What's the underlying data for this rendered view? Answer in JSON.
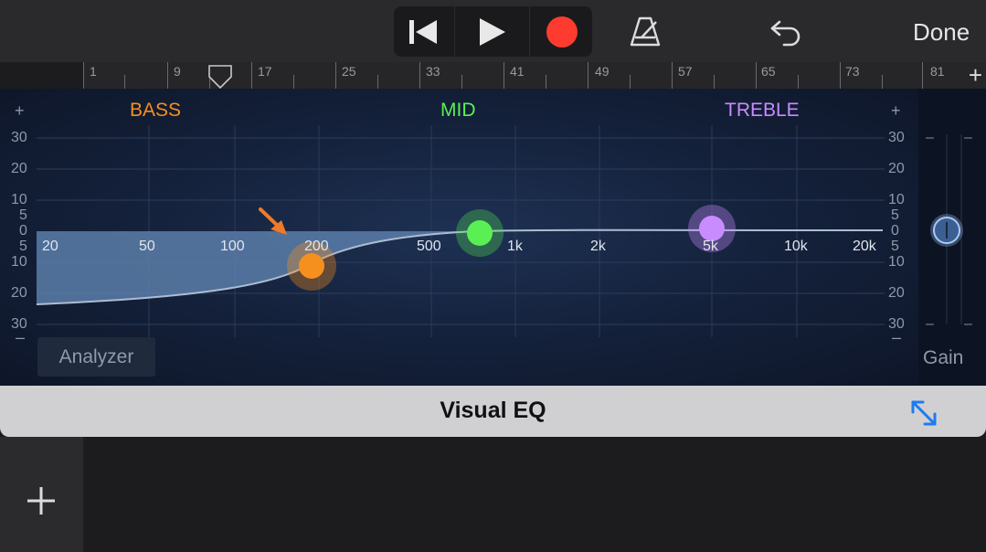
{
  "header": {
    "done_label": "Done",
    "transport_icons": [
      "go-to-beginning-icon",
      "play-icon",
      "record-icon"
    ],
    "metronome_icon": "metronome-icon",
    "undo_icon": "undo-icon"
  },
  "ruler": {
    "bars": [
      "1",
      "9",
      "17",
      "25",
      "33",
      "41",
      "49",
      "57",
      "65",
      "73",
      "81"
    ],
    "add_label": "+"
  },
  "eq": {
    "bands": {
      "bass": "BASS",
      "mid": "MID",
      "treble": "TREBLE"
    },
    "add_left": "+",
    "add_right": "+",
    "minus_left": "–",
    "minus_right": "–",
    "db_labels": [
      "30",
      "20",
      "10",
      "5",
      "0",
      "5",
      "10",
      "20",
      "30"
    ],
    "freq_labels": [
      "20",
      "50",
      "100",
      "200",
      "500",
      "1k",
      "2k",
      "5k",
      "10k",
      "20k"
    ],
    "analyzer_label": "Analyzer",
    "gain_label": "Gain",
    "colors": {
      "bass": "#f5901e",
      "mid": "#5af054",
      "treble": "#c88cff",
      "gain_knob": "#a9c8ff"
    },
    "bass_knob": {
      "freq": "190 Hz",
      "gain_db": -11
    },
    "mid_knob": {
      "freq": "750 Hz",
      "gain_db": -1
    },
    "treble_knob": {
      "freq": "5k Hz",
      "gain_db": 0
    },
    "gain_level_db": 0
  },
  "title_bar": {
    "title": "Visual EQ",
    "expand_icon": "expand-icon"
  },
  "sidebar": {
    "add_icon": "plus-icon"
  },
  "annotation": {
    "arrow_icon": "pointer-arrow-icon",
    "color": "#f07a28"
  }
}
